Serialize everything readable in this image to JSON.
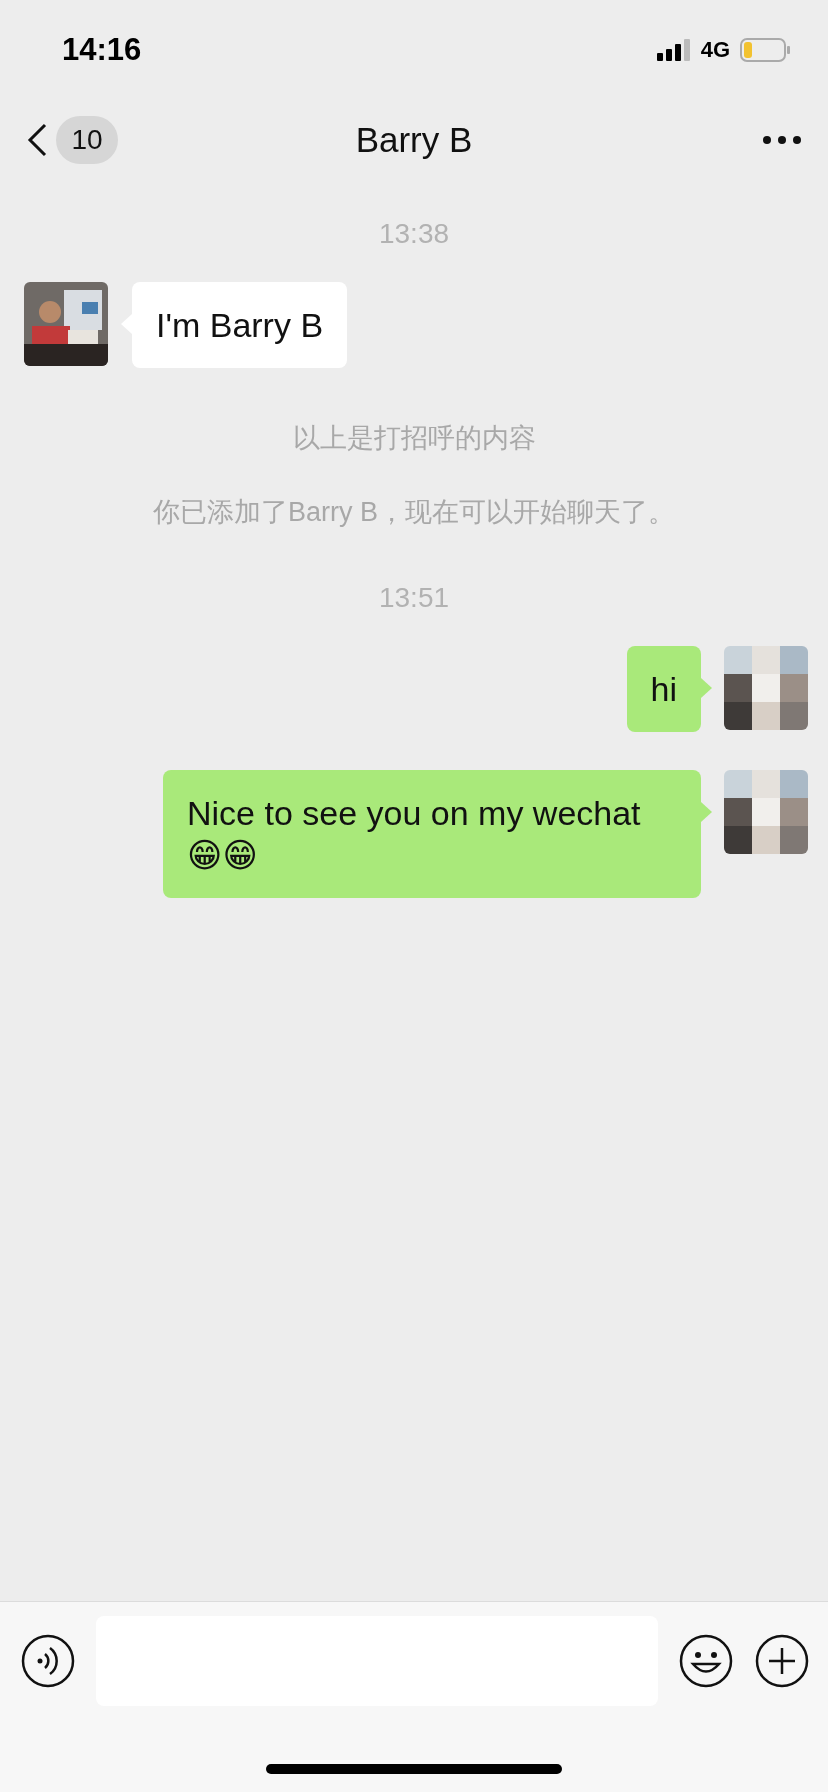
{
  "status_bar": {
    "time": "14:16",
    "network": "4G"
  },
  "nav": {
    "back_badge": "10",
    "title": "Barry B"
  },
  "messages": [
    {
      "kind": "time",
      "text": "13:38"
    },
    {
      "kind": "incoming",
      "text": "I'm Barry B"
    },
    {
      "kind": "system",
      "text": "以上是打招呼的内容"
    },
    {
      "kind": "system",
      "text": "你已添加了Barry B，现在可以开始聊天了。"
    },
    {
      "kind": "time",
      "text": "13:51"
    },
    {
      "kind": "outgoing",
      "text": "hi"
    },
    {
      "kind": "outgoing",
      "text": "Nice to see you on my wechat 😁😁"
    }
  ]
}
